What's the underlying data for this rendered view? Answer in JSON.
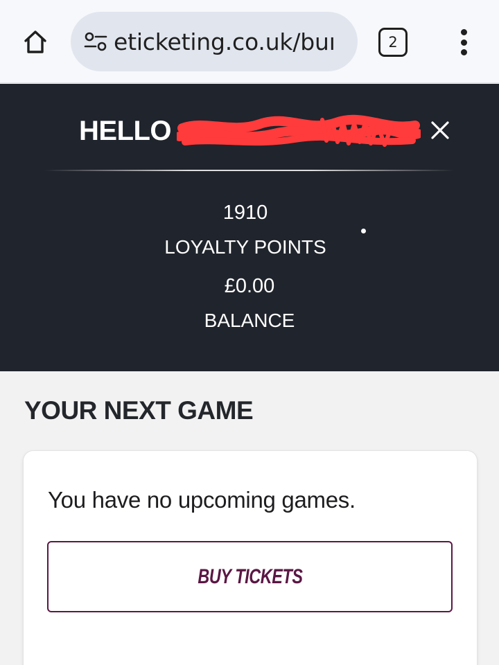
{
  "browser": {
    "url": "eticketing.co.uk/buı",
    "tab_count": "2",
    "icons": {
      "home": "home-icon",
      "site_info": "tune-icon",
      "menu": "more-vert-icon"
    }
  },
  "account": {
    "greeting": "HELLO",
    "name_redacted": true,
    "points_value": "1910",
    "points_label": "LOYALTY POINTS",
    "balance_value": "£0.00",
    "balance_label": "BALANCE",
    "close_icon": "close-icon"
  },
  "next_game": {
    "title": "YOUR NEXT GAME",
    "message": "You have no upcoming games.",
    "buy_label": "BUY TICKETS"
  },
  "colors": {
    "panel_bg": "#20242c",
    "page_bg": "#f2f2f2",
    "accent": "#5a1744",
    "redaction": "#ff3b3b"
  }
}
